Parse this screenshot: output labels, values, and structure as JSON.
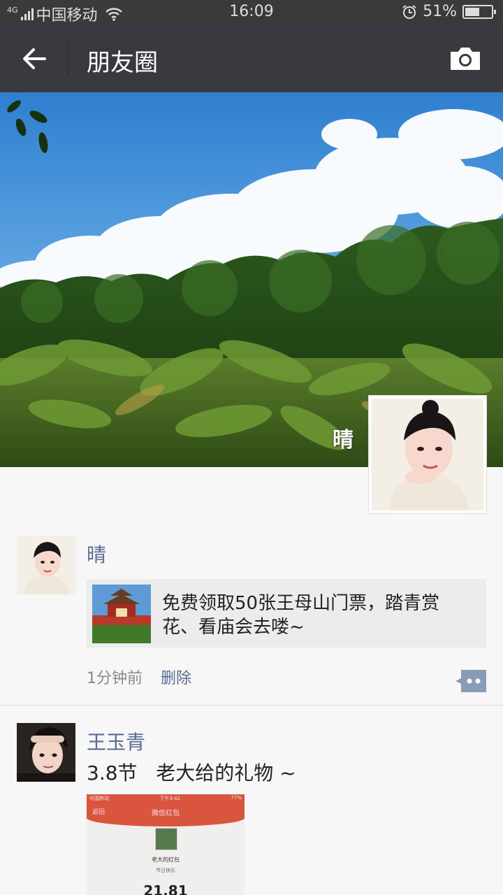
{
  "status_bar": {
    "network": "4G",
    "carrier": "中国移动",
    "time": "16:09",
    "battery": "51%",
    "icons": [
      "signal-icon",
      "wifi-icon",
      "alarm-icon",
      "battery-icon"
    ]
  },
  "header": {
    "title": "朋友圈",
    "back_icon": "arrow-left-icon",
    "camera_icon": "camera-icon",
    "background": "#393a3f"
  },
  "profile": {
    "name": "晴"
  },
  "posts": [
    {
      "author": "晴",
      "link_title": "免费领取50张王母山门票，踏青赏花、看庙会去喽~",
      "time": "1分钟前",
      "delete_label": "删除",
      "comment_icon": "comment-dots-icon"
    },
    {
      "author": "王玉青",
      "text": "3.8节   老大给的礼物 ~",
      "image": {
        "carrier": "中国移动",
        "time": "下午3:42",
        "battery": "77%",
        "back_label": "返回",
        "title": "微信红包",
        "sender": "老大的红包",
        "greeting": "节日快乐",
        "amount": "21.81"
      }
    }
  ],
  "colors": {
    "name_link": "#576b95",
    "muted": "#8a8a8a",
    "card_bg": "#ececec",
    "page_bg": "#f7f7f7"
  }
}
